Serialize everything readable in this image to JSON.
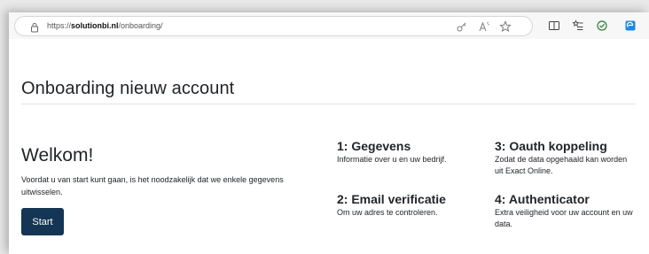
{
  "browser": {
    "url_prefix": "https://",
    "url_host": "solutionbi.nl",
    "url_path": "/onboarding/",
    "icons": [
      "lock-icon",
      "password-key-icon",
      "read-aloud-icon",
      "favorite-star-icon",
      "split-screen-icon",
      "favorites-list-icon",
      "extension-icon",
      "edge-profile-icon"
    ]
  },
  "page": {
    "title": "Onboarding nieuw account",
    "welcome": {
      "title": "Welkom!",
      "text": "Voordat u van start kunt gaan, is het noodzakelijk dat we enkele gegevens uitwisselen.",
      "button_label": "Start"
    },
    "steps": [
      {
        "title": "1: Gegevens",
        "description": "Informatie over u en uw bedrijf."
      },
      {
        "title": "2: Email verificatie",
        "description": "Om uw adres te controleren."
      },
      {
        "title": "3: Oauth koppeling",
        "description": "Zodat de data opgehaald kan worden uit Exact Online."
      },
      {
        "title": "4: Authenticator",
        "description": "Extra veiligheid voor uw account en uw data."
      }
    ]
  },
  "colors": {
    "button_bg": "#143553",
    "text": "#212529"
  }
}
